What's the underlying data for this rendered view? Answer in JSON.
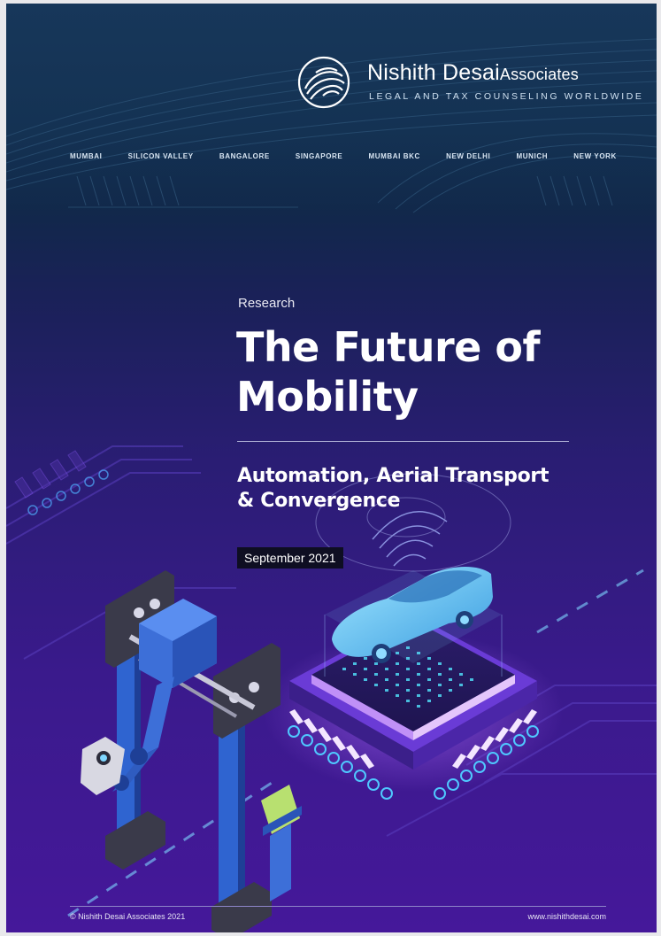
{
  "brand": {
    "name": "Nishith Desai",
    "name_suffix": "Associates",
    "tagline": "LEGAL AND TAX COUNSELING WORLDWIDE"
  },
  "cities": [
    "MUMBAI",
    "SILICON VALLEY",
    "BANGALORE",
    "SINGAPORE",
    "MUMBAI BKC",
    "NEW DELHI",
    "MUNICH",
    "NEW YORK"
  ],
  "category": "Research",
  "title_line1": "The Future of",
  "title_line2": "Mobility",
  "subtitle_line1": "Automation, Aerial Transport",
  "subtitle_line2": "& Convergence",
  "date": "September 2021",
  "footer": {
    "copyright": "© Nishith Desai Associates 2021",
    "website": "www.nishithdesai.com"
  },
  "colors": {
    "header_bg": "#143253",
    "accent_purple": "#3a1a8c",
    "circuit_cyan": "#3fc6ff",
    "robot_blue": "#3a6fd8"
  }
}
